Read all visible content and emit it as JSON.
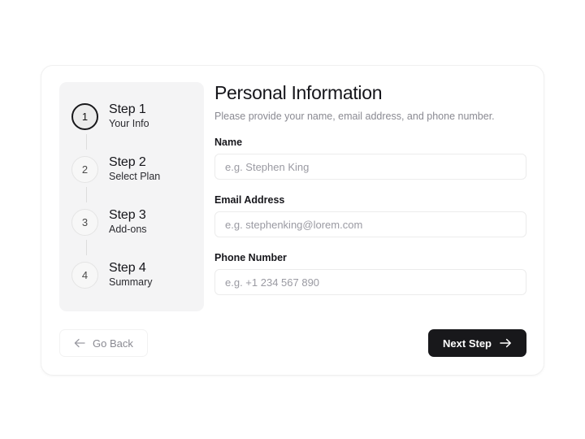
{
  "sidebar": {
    "steps": [
      {
        "number": "1",
        "title": "Step 1",
        "subtitle": "Your Info",
        "active": true
      },
      {
        "number": "2",
        "title": "Step 2",
        "subtitle": "Select Plan",
        "active": false
      },
      {
        "number": "3",
        "title": "Step 3",
        "subtitle": "Add-ons",
        "active": false
      },
      {
        "number": "4",
        "title": "Step 4",
        "subtitle": "Summary",
        "active": false
      }
    ]
  },
  "main": {
    "title": "Personal Information",
    "subtitle": "Please provide your name, email address, and phone number.",
    "fields": [
      {
        "label": "Name",
        "value": "",
        "placeholder": "e.g. Stephen King"
      },
      {
        "label": "Email Address",
        "value": "",
        "placeholder": "e.g. stephenking@lorem.com"
      },
      {
        "label": "Phone Number",
        "value": "",
        "placeholder": "e.g. +1 234 567 890"
      }
    ]
  },
  "footer": {
    "back_label": "Go Back",
    "next_label": "Next Step"
  },
  "colors": {
    "accent": "#18181b",
    "sidebar_bg": "#f4f4f5",
    "muted_text": "#8a8a92",
    "border": "#ececec"
  }
}
